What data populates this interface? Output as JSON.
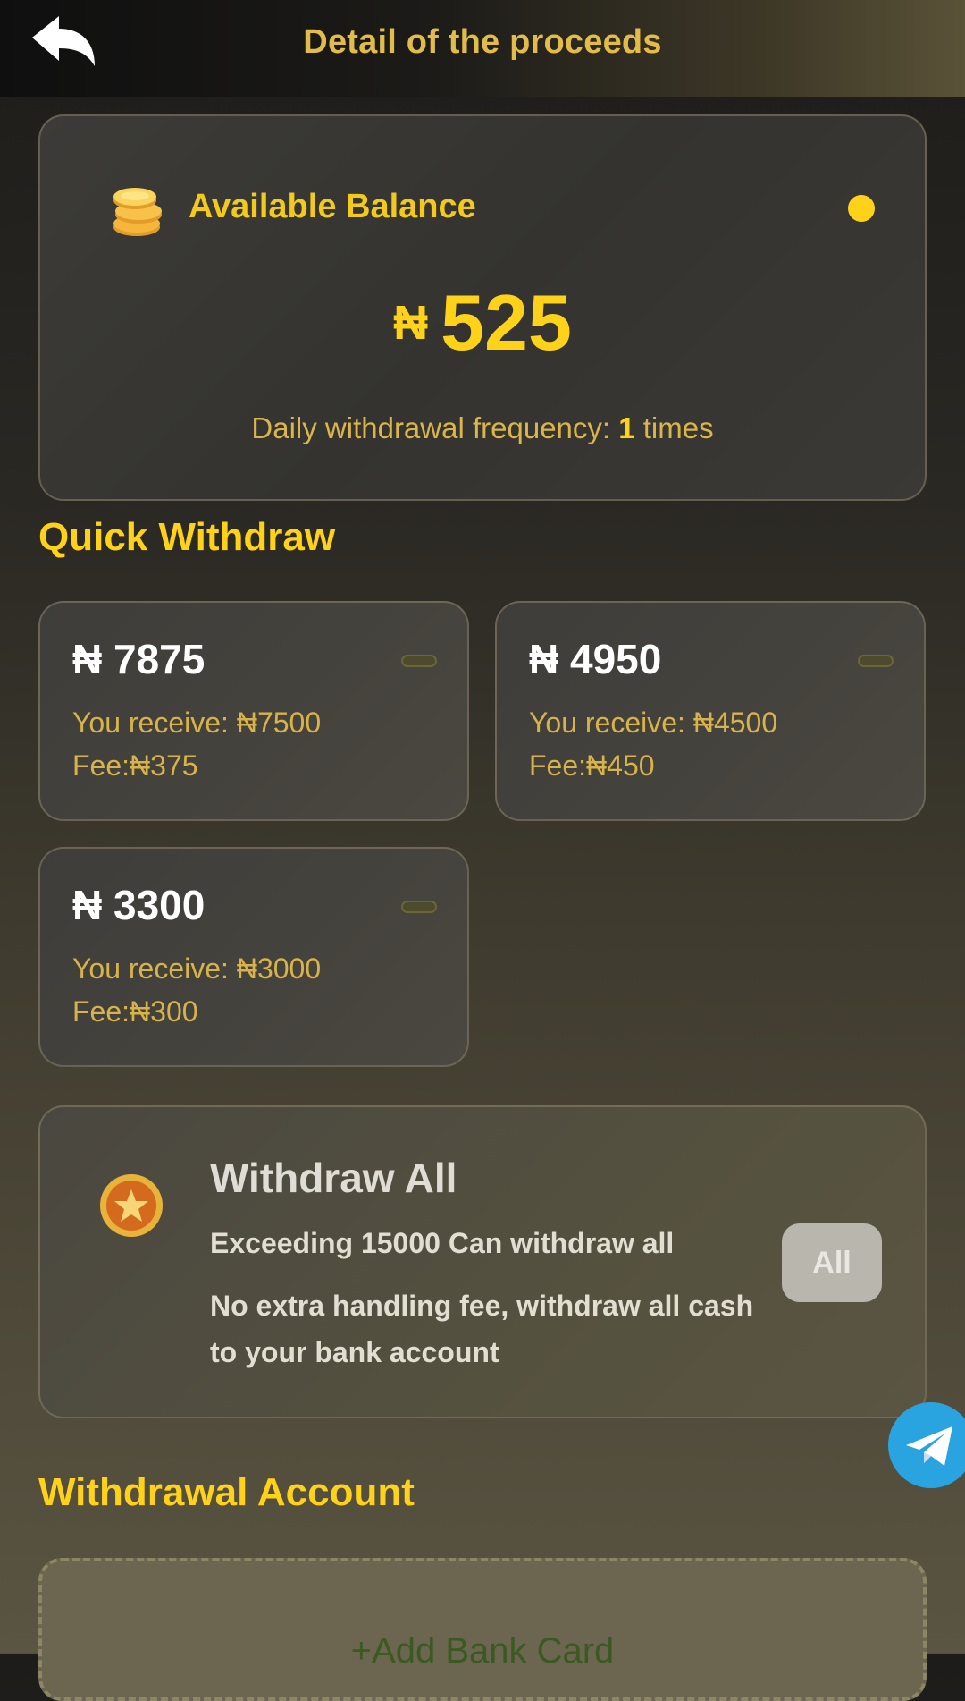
{
  "header": {
    "title": "Detail of the proceeds",
    "back_icon": "back-arrow-icon"
  },
  "balance": {
    "label": "Available Balance",
    "currency": "₦",
    "amount": "525",
    "frequency_prefix": "Daily withdrawal frequency: ",
    "frequency_count": "1",
    "frequency_suffix": " times",
    "coin_icon": "coins-icon",
    "dot_color": "#ffd21a"
  },
  "quick_withdraw": {
    "title": "Quick Withdraw",
    "options": [
      {
        "amount": "₦ 7875",
        "receive": "You receive: ₦7500",
        "fee": "Fee:₦375"
      },
      {
        "amount": "₦ 4950",
        "receive": "You receive: ₦4500",
        "fee": "Fee:₦450"
      },
      {
        "amount": "₦ 3300",
        "receive": "You receive: ₦3000",
        "fee": "Fee:₦300"
      }
    ]
  },
  "withdraw_all": {
    "title": "Withdraw All",
    "line1": "Exceeding 15000 Can withdraw all",
    "line2": "No extra handling fee, withdraw all cash to your bank account",
    "button_label": "All",
    "badge_icon": "star-badge-icon"
  },
  "withdrawal_account": {
    "title": "Withdrawal Account",
    "add_label": "+Add Bank Card"
  },
  "floating": {
    "icon": "telegram-icon",
    "color": "#2aa4e0"
  },
  "colors": {
    "accent": "#ffd21a",
    "gold_text": "#d8b24a"
  }
}
